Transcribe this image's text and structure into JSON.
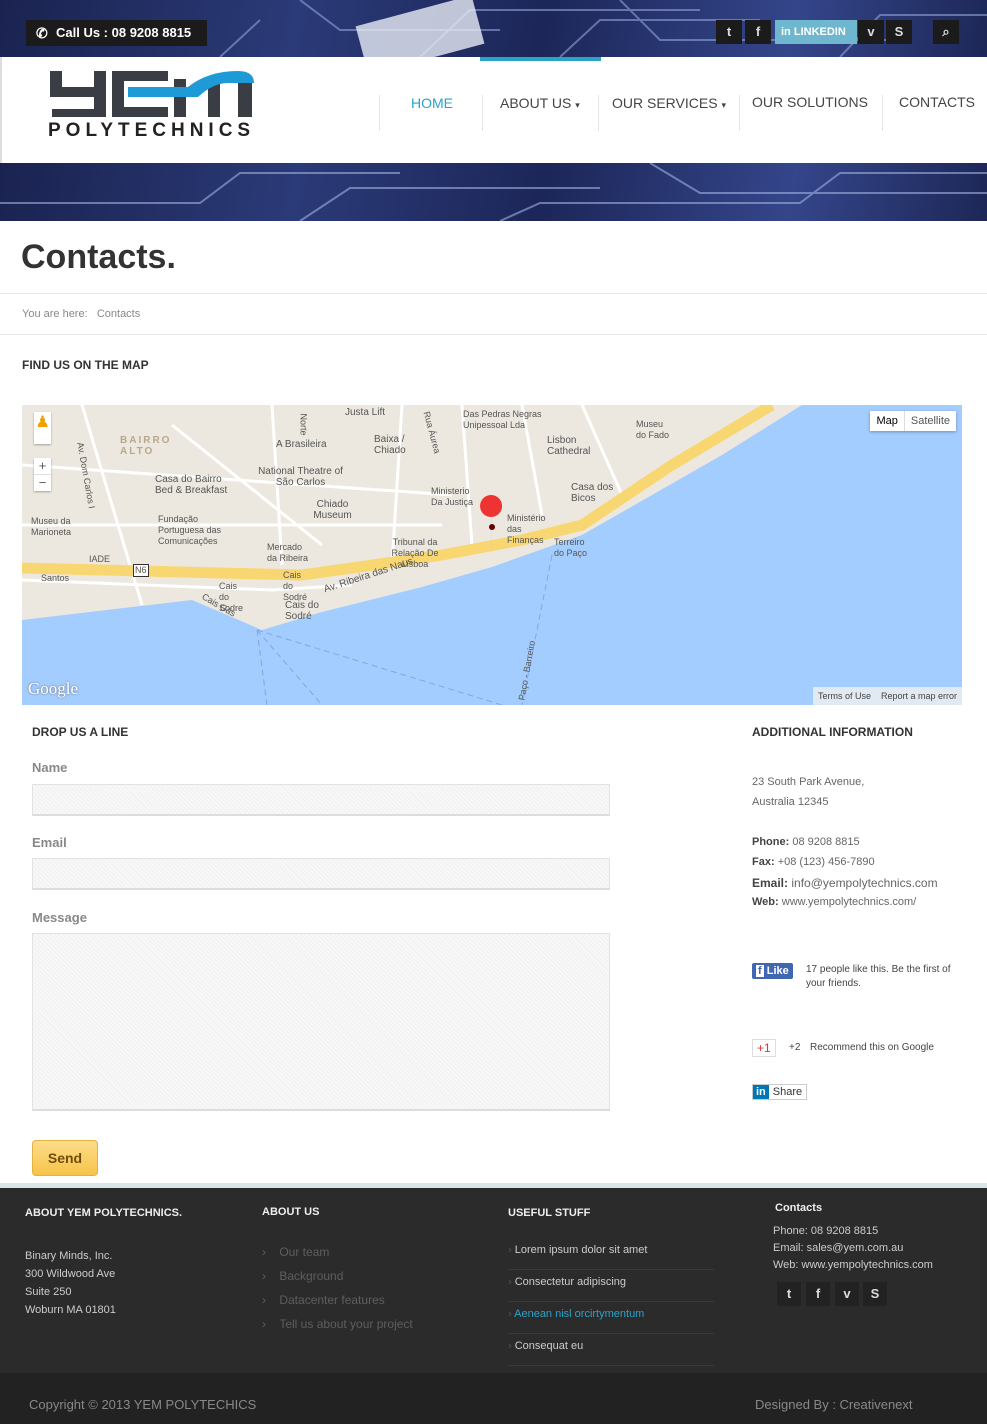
{
  "topbar": {
    "call": "Call Us : 08 9208 8815",
    "linkedin": "LINKEDIN",
    "social": [
      "twitter",
      "facebook",
      "linkedin",
      "vimeo",
      "skype",
      "search"
    ]
  },
  "logo": {
    "mark": "YEM",
    "sub": "POLYTECHNICS"
  },
  "nav": [
    "HOME",
    "ABOUT US",
    "OUR SERVICES",
    "OUR SOLUTIONS",
    "CONTACTS"
  ],
  "page": {
    "title": "Contacts.",
    "breadcrumb_label": "You are here:",
    "breadcrumb_current": "Contacts",
    "map_title": "FIND US ON THE MAP"
  },
  "map": {
    "type_buttons": [
      "Map",
      "Satellite"
    ],
    "logo": "Google",
    "terms": "Terms of Use",
    "report": "Report a map error",
    "labels": [
      "BAIRRO ALTO",
      "A Brasileira",
      "Baixa / Chiado",
      "National Theatre of São Carlos",
      "Casa do Bairro Bed & Breakfast",
      "Chiado Museum",
      "Museu da Marioneta",
      "Fundação Portuguesa das Comunicações",
      "Mercado da Ribeira",
      "IADE",
      "N6",
      "Santos",
      "Cais do Sodre",
      "Cais do Sodré",
      "Cais do Sodré",
      "Av. Ribeira das Naus",
      "Tribunal da Relação De Lisboa",
      "Ministerio Da Justiça",
      "Lisbon Cathedral",
      "Casa dos Bicos",
      "Ministério das Finanças",
      "Terreiro do Paço",
      "Museu do Fado",
      "Das Pedras Negras Unipessoal Lda",
      "Justa Lift",
      "Rua Áurea",
      "Av. Dom Carlos I",
      "Norte",
      "Cais Gás",
      "Paço - Barreiro"
    ]
  },
  "form": {
    "title": "DROP US A LINE",
    "name_label": "Name",
    "email_label": "Email",
    "message_label": "Message",
    "send": "Send"
  },
  "info": {
    "title": "ADDITIONAL INFORMATION",
    "address1": "23 South Park Avenue,",
    "address2": "Australia 12345",
    "phone_label": "Phone:",
    "phone": "08 9208 8815",
    "fax_label": "Fax:",
    "fax": "+08 (123) 456-7890",
    "email_label": "Email:",
    "email": "info@yempolytechnics.com",
    "web_label": "Web:",
    "web": "www.yempolytechnics.com/",
    "fb_like": "Like",
    "fb_text": "17 people like this. Be the first of your friends.",
    "gplus": "+1",
    "gplus_count": "+2",
    "gplus_text": "Recommend this on Google",
    "li_share": "Share"
  },
  "footer": {
    "about_title": "ABOUT YEM POLYTECHNICS.",
    "address": [
      "Binary Minds, Inc.",
      "300 Wildwood Ave",
      "Suite 250",
      "Woburn MA 01801"
    ],
    "aboutus_title": "ABOUT US",
    "aboutus_links": [
      "Our team",
      "Background",
      "Datacenter features",
      "Tell us about your project"
    ],
    "useful_title": "USEFUL STUFF",
    "useful_links": [
      "Lorem ipsum dolor sit amet",
      "Consectetur adipiscing",
      "Aenean nisl orcirtymentum",
      "Consequat eu"
    ],
    "contacts_title": "Contacts",
    "phone": "Phone: 08 9208 8815",
    "email": "Email: sales@yem.com.au",
    "web": "Web: www.yempolytechnics.com",
    "copyright": "Copyright © 2013 YEM POLYTECHICS",
    "designed": "Designed By :  Creativenext"
  },
  "colors": {
    "accent": "#2aa3c7",
    "send": "#f7c449",
    "footer": "#2b2b2b"
  }
}
